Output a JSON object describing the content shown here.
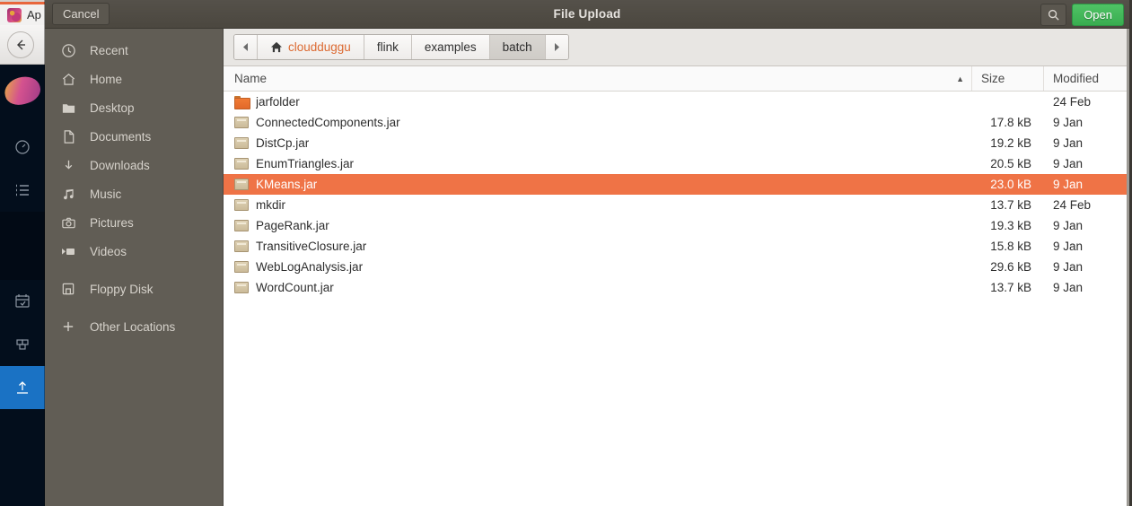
{
  "background": {
    "tab_title": "Ap",
    "favicon": "flink-squirrel-icon",
    "back_button": "back-arrow-icon",
    "rail": {
      "logo": "flink-squirrel-logo",
      "items": [
        {
          "icon": "dashboard-gauge-icon",
          "active": false
        },
        {
          "icon": "list-icon",
          "active": false
        },
        {
          "icon": "calendar-check-icon",
          "active": false
        },
        {
          "icon": "grid-blocks-icon",
          "active": false
        },
        {
          "icon": "upload-icon",
          "active": true
        }
      ]
    }
  },
  "dialog": {
    "title": "File Upload",
    "cancel_label": "Cancel",
    "search_icon": "search-icon",
    "open_label": "Open",
    "accent_open": "#3caf52",
    "accent_selection": "#ef7346",
    "places": [
      {
        "label": "Recent",
        "icon": "clock-icon"
      },
      {
        "label": "Home",
        "icon": "home-icon"
      },
      {
        "label": "Desktop",
        "icon": "folder-icon"
      },
      {
        "label": "Documents",
        "icon": "document-icon"
      },
      {
        "label": "Downloads",
        "icon": "download-icon"
      },
      {
        "label": "Music",
        "icon": "music-note-icon"
      },
      {
        "label": "Pictures",
        "icon": "camera-icon"
      },
      {
        "label": "Videos",
        "icon": "video-icon"
      },
      {
        "label": "Floppy Disk",
        "icon": "floppy-disk-icon"
      },
      {
        "label": "Other Locations",
        "icon": "plus-icon"
      }
    ],
    "breadcrumb": {
      "prev_arrow": "chevron-left-icon",
      "next_arrow": "chevron-right-icon",
      "items": [
        {
          "label": "cloudduggu",
          "home": true,
          "active": false
        },
        {
          "label": "flink",
          "home": false,
          "active": false
        },
        {
          "label": "examples",
          "home": false,
          "active": false
        },
        {
          "label": "batch",
          "home": false,
          "active": true
        }
      ]
    },
    "columns": {
      "name": "Name",
      "size": "Size",
      "modified": "Modified",
      "sort_caret": "▲"
    },
    "files": [
      {
        "name": "jarfolder",
        "size": "",
        "modified": "24 Feb",
        "icon": "folder-icon",
        "selected": false
      },
      {
        "name": "ConnectedComponents.jar",
        "size": "17.8 kB",
        "modified": "9 Jan",
        "icon": "archive-icon",
        "selected": false
      },
      {
        "name": "DistCp.jar",
        "size": "19.2 kB",
        "modified": "9 Jan",
        "icon": "archive-icon",
        "selected": false
      },
      {
        "name": "EnumTriangles.jar",
        "size": "20.5 kB",
        "modified": "9 Jan",
        "icon": "archive-icon",
        "selected": false
      },
      {
        "name": "KMeans.jar",
        "size": "23.0 kB",
        "modified": "9 Jan",
        "icon": "archive-icon",
        "selected": true
      },
      {
        "name": "mkdir",
        "size": "13.7 kB",
        "modified": "24 Feb",
        "icon": "archive-icon",
        "selected": false
      },
      {
        "name": "PageRank.jar",
        "size": "19.3 kB",
        "modified": "9 Jan",
        "icon": "archive-icon",
        "selected": false
      },
      {
        "name": "TransitiveClosure.jar",
        "size": "15.8 kB",
        "modified": "9 Jan",
        "icon": "archive-icon",
        "selected": false
      },
      {
        "name": "WebLogAnalysis.jar",
        "size": "29.6 kB",
        "modified": "9 Jan",
        "icon": "archive-icon",
        "selected": false
      },
      {
        "name": "WordCount.jar",
        "size": "13.7 kB",
        "modified": "9 Jan",
        "icon": "archive-icon",
        "selected": false
      }
    ]
  }
}
